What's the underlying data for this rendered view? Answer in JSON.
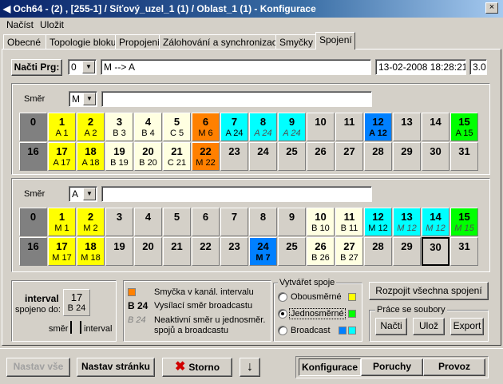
{
  "window": {
    "title": "Och64 - (2) , [255-1] / Síťový_uzel_1 (1) / Oblast_1 (1) - Konfigurace",
    "close": "×"
  },
  "menu": [
    "Načíst",
    "Uložit"
  ],
  "tabs": [
    "Obecné",
    "Topologie bloku",
    "Propojení",
    "Zálohování a synchronizace",
    "Smyčky",
    "Spojení"
  ],
  "active_tab": "Spojení",
  "top": {
    "load_btn": "Načti Prg:",
    "program": "0",
    "name": "M --> A",
    "datetime": "13-02-2008 18:28:21",
    "version": "3.0"
  },
  "section1": {
    "smer_label": "Směr",
    "smer": "M",
    "smer_text": ""
  },
  "section2": {
    "smer_label": "Směr",
    "smer": "A",
    "smer_text": ""
  },
  "colors": {
    "gray": "#808080",
    "yellow": "#ffff00",
    "cream": "#ffffe1",
    "orange": "#ff8000",
    "cyan": "#00ffff",
    "blue": "#0080ff",
    "green": "#00ff00",
    "default": "#d4d0c8"
  },
  "grid1": [
    [
      {
        "n": "0",
        "s": "",
        "c": "gray"
      },
      {
        "n": "1",
        "s": "A 1",
        "c": "yellow"
      },
      {
        "n": "2",
        "s": "A 2",
        "c": "yellow"
      },
      {
        "n": "3",
        "s": "B 3",
        "c": "cream"
      },
      {
        "n": "4",
        "s": "B 4",
        "c": "cream"
      },
      {
        "n": "5",
        "s": "C 5",
        "c": "cream"
      },
      {
        "n": "6",
        "s": "M 6",
        "c": "orange"
      },
      {
        "n": "7",
        "s": "A 24",
        "c": "cyan"
      },
      {
        "n": "8",
        "s": "A 24",
        "c": "cyan",
        "i": true
      },
      {
        "n": "9",
        "s": "A 24",
        "c": "cyan",
        "i": true
      },
      {
        "n": "10",
        "s": "",
        "c": "default"
      },
      {
        "n": "11",
        "s": "",
        "c": "default"
      },
      {
        "n": "12",
        "s": "A 12",
        "c": "blue",
        "b": true
      },
      {
        "n": "13",
        "s": "",
        "c": "default"
      },
      {
        "n": "14",
        "s": "",
        "c": "default"
      },
      {
        "n": "15",
        "s": "A 15",
        "c": "green"
      }
    ],
    [
      {
        "n": "16",
        "s": "",
        "c": "gray"
      },
      {
        "n": "17",
        "s": "A 17",
        "c": "yellow"
      },
      {
        "n": "18",
        "s": "A 18",
        "c": "yellow"
      },
      {
        "n": "19",
        "s": "B 19",
        "c": "cream"
      },
      {
        "n": "20",
        "s": "B 20",
        "c": "cream"
      },
      {
        "n": "21",
        "s": "C 21",
        "c": "cream"
      },
      {
        "n": "22",
        "s": "M 22",
        "c": "orange"
      },
      {
        "n": "23",
        "s": "",
        "c": "default"
      },
      {
        "n": "24",
        "s": "",
        "c": "default"
      },
      {
        "n": "25",
        "s": "",
        "c": "default"
      },
      {
        "n": "26",
        "s": "",
        "c": "default"
      },
      {
        "n": "27",
        "s": "",
        "c": "default"
      },
      {
        "n": "28",
        "s": "",
        "c": "default"
      },
      {
        "n": "29",
        "s": "",
        "c": "default"
      },
      {
        "n": "30",
        "s": "",
        "c": "default"
      },
      {
        "n": "31",
        "s": "",
        "c": "default"
      }
    ]
  ],
  "grid2": [
    [
      {
        "n": "0",
        "s": "",
        "c": "gray"
      },
      {
        "n": "1",
        "s": "M 1",
        "c": "yellow"
      },
      {
        "n": "2",
        "s": "M 2",
        "c": "yellow"
      },
      {
        "n": "3",
        "s": "",
        "c": "default"
      },
      {
        "n": "4",
        "s": "",
        "c": "default"
      },
      {
        "n": "5",
        "s": "",
        "c": "default"
      },
      {
        "n": "6",
        "s": "",
        "c": "default"
      },
      {
        "n": "7",
        "s": "",
        "c": "default"
      },
      {
        "n": "8",
        "s": "",
        "c": "default"
      },
      {
        "n": "9",
        "s": "",
        "c": "default"
      },
      {
        "n": "10",
        "s": "B 10",
        "c": "cream"
      },
      {
        "n": "11",
        "s": "B 11",
        "c": "cream"
      },
      {
        "n": "12",
        "s": "M 12",
        "c": "cyan"
      },
      {
        "n": "13",
        "s": "M 12",
        "c": "cyan",
        "i": true
      },
      {
        "n": "14",
        "s": "M 12",
        "c": "cyan",
        "i": true
      },
      {
        "n": "15",
        "s": "M 15",
        "c": "green",
        "i": true
      }
    ],
    [
      {
        "n": "16",
        "s": "",
        "c": "gray"
      },
      {
        "n": "17",
        "s": "M 17",
        "c": "yellow"
      },
      {
        "n": "18",
        "s": "M 18",
        "c": "yellow"
      },
      {
        "n": "19",
        "s": "",
        "c": "default"
      },
      {
        "n": "20",
        "s": "",
        "c": "default"
      },
      {
        "n": "21",
        "s": "",
        "c": "default"
      },
      {
        "n": "22",
        "s": "",
        "c": "default"
      },
      {
        "n": "23",
        "s": "",
        "c": "default"
      },
      {
        "n": "24",
        "s": "M 7",
        "c": "blue",
        "b": true
      },
      {
        "n": "25",
        "s": "",
        "c": "default"
      },
      {
        "n": "26",
        "s": "B 26",
        "c": "cream"
      },
      {
        "n": "27",
        "s": "B 27",
        "c": "cream"
      },
      {
        "n": "28",
        "s": "",
        "c": "default"
      },
      {
        "n": "29",
        "s": "",
        "c": "default"
      },
      {
        "n": "30",
        "s": "",
        "c": "default",
        "sel": true
      },
      {
        "n": "31",
        "s": "",
        "c": "default"
      }
    ]
  ],
  "interval": {
    "label": "interval",
    "spojeno": "spojeno do:",
    "num": "17",
    "value": "B 24",
    "smer": "směr",
    "interval2": "interval"
  },
  "legend": {
    "item1": "Smyčka v kanál. intervalu",
    "item2_code": "B 24",
    "item2": "Vysílací směr broadcastu",
    "item3_code": "B 24",
    "item3_line1": "Neaktivní směr u jednosměr.",
    "item3_line2": "spojů a broadcastu"
  },
  "create": {
    "title": "Vytvářet spoje",
    "options": [
      "Obousměrné",
      "Jednosměrné",
      "Broadcast"
    ],
    "selected": 1
  },
  "right": {
    "disconnect": "Rozpojit všechna spojení",
    "files_title": "Práce se soubory",
    "load": "Načti",
    "save": "Ulož",
    "export": "Export"
  },
  "bottom": {
    "set_all": "Nastav vše",
    "set_page": "Nastav stránku",
    "cancel": "Storno",
    "arrow": "↓",
    "configure": "Konfigurace",
    "faults": "Poruchy",
    "operation": "Provoz"
  }
}
